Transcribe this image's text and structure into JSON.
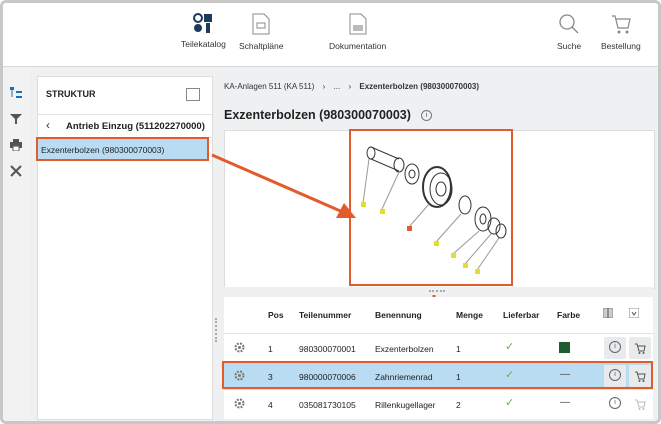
{
  "toolbar": {
    "catalog_label": "Teilekatalog",
    "schematics_label": "Schaltpläne",
    "docs_label": "Dokumentation",
    "search_label": "Suche",
    "order_label": "Bestellung"
  },
  "structure": {
    "heading": "STRUKTUR",
    "parent": "Antrieb Einzug (511202270000)",
    "selected_item": "Exzenterbolzen (980300070003)"
  },
  "breadcrumb": {
    "root": "KA-Anlagen 511 (KA 511)",
    "sep1": "›",
    "ellipsis": "...",
    "sep2": "›",
    "current": "Exzenterbolzen (980300070003)"
  },
  "page_title": "Exzenterbolzen (980300070003)",
  "table": {
    "headers": {
      "pos": "Pos",
      "part_no": "Teilenummer",
      "name": "Benennung",
      "qty": "Menge",
      "avail": "Lieferbar",
      "color": "Farbe"
    },
    "rows": [
      {
        "pos": "1",
        "part_no": "980300070001",
        "name": "Exzenterbolzen",
        "qty": "1",
        "color": "",
        "color_hex": "#1e5e2e"
      },
      {
        "pos": "3",
        "part_no": "980000070006",
        "name": "Zahnriemenrad",
        "qty": "1",
        "color": "—"
      },
      {
        "pos": "4",
        "part_no": "035081730105",
        "name": "Rillenkugellager",
        "qty": "2",
        "color": "—"
      }
    ]
  },
  "colors": {
    "highlight": "#e35a2c",
    "selected_row": "#b9dcf3",
    "available": "#6ab04c"
  }
}
